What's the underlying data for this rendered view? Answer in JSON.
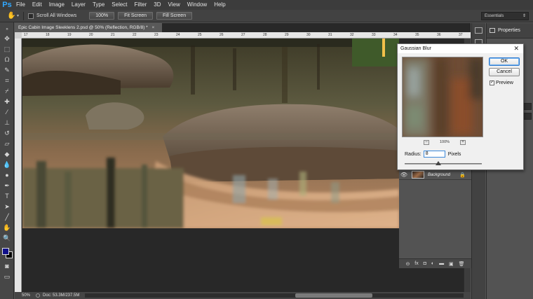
{
  "app": {
    "logo": "Ps"
  },
  "menu": [
    "File",
    "Edit",
    "Image",
    "Layer",
    "Type",
    "Select",
    "Filter",
    "3D",
    "View",
    "Window",
    "Help"
  ],
  "options_bar": {
    "tool_icon": "hand-tool-icon",
    "scroll_all_windows_label": "Scroll All Windows",
    "scroll_all_windows_checked": false,
    "btn_100": "100%",
    "btn_fit": "Fit Screen",
    "btn_fill": "Fill Screen",
    "workspace": "Essentials"
  },
  "document": {
    "tab_title": "Epic Cabin Image Sleeklens 2.psd @ 50% (Reflection, RGB/8) *",
    "tab_close": "×",
    "ruler_ticks": [
      "17",
      "18",
      "19",
      "20",
      "21",
      "22",
      "23",
      "24",
      "25",
      "26",
      "27",
      "28",
      "29",
      "30",
      "31",
      "32",
      "33",
      "34",
      "35",
      "36",
      "37"
    ],
    "zoom": "50%",
    "doc_size": "Doc: 53.3M/237.5M"
  },
  "properties_panel": {
    "title": "Properties"
  },
  "layers": {
    "rows": [
      {
        "name": "Background",
        "visible": true,
        "locked": true
      }
    ]
  },
  "dialog": {
    "title": "Gaussian Blur",
    "close": "✕",
    "ok": "OK",
    "cancel": "Cancel",
    "preview_label": "Preview",
    "preview_checked": true,
    "preview_zoom": "100%",
    "zoom_out": "−",
    "zoom_in": "+",
    "radius_label": "Radius:",
    "radius_value": "8",
    "radius_unit": "Pixels"
  },
  "colors": {
    "foreground": "#10108a",
    "background": "#050505",
    "accent": "#31a8ff"
  }
}
